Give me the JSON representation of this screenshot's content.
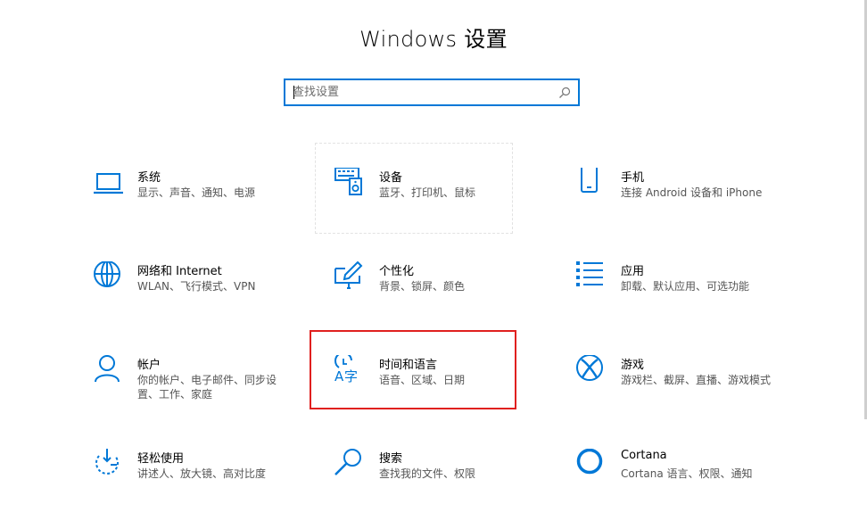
{
  "window": {
    "title": "Windows 设置"
  },
  "search": {
    "placeholder": "查找设置"
  },
  "colors": {
    "accent": "#0078d7",
    "highlight": "#e0201f"
  },
  "tiles": [
    {
      "title": "系统",
      "desc": "显示、声音、通知、电源",
      "icon": "laptop-icon"
    },
    {
      "title": "设备",
      "desc": "蓝牙、打印机、鼠标",
      "icon": "keyboard-speaker-icon"
    },
    {
      "title": "手机",
      "desc": "连接 Android 设备和 iPhone",
      "icon": "phone-icon"
    },
    {
      "title": "网络和 Internet",
      "desc": "WLAN、飞行模式、VPN",
      "icon": "globe-icon"
    },
    {
      "title": "个性化",
      "desc": "背景、锁屏、颜色",
      "icon": "paint-brush-icon"
    },
    {
      "title": "应用",
      "desc": "卸载、默认应用、可选功能",
      "icon": "apps-list-icon"
    },
    {
      "title": "帐户",
      "desc": "你的帐户、电子邮件、同步设置、工作、家庭",
      "icon": "person-icon"
    },
    {
      "title": "时间和语言",
      "desc": "语音、区域、日期",
      "icon": "time-language-icon"
    },
    {
      "title": "游戏",
      "desc": "游戏栏、截屏、直播、游戏模式",
      "icon": "xbox-icon"
    },
    {
      "title": "轻松使用",
      "desc": "讲述人、放大镜、高对比度",
      "icon": "ease-of-access-icon"
    },
    {
      "title": "搜索",
      "desc": "查找我的文件、权限",
      "icon": "search-icon"
    },
    {
      "title": "Cortana",
      "desc": "Cortana 语言、权限、通知",
      "icon": "cortana-icon"
    }
  ]
}
